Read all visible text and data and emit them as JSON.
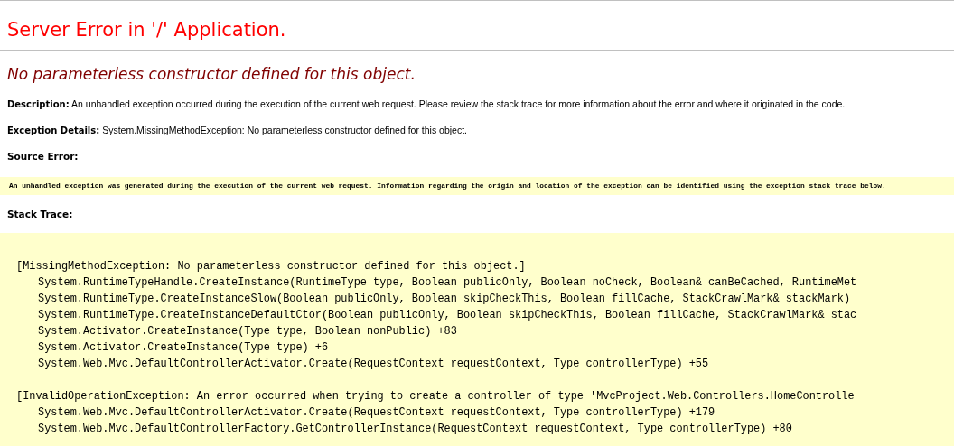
{
  "title": "Server Error in '/' Application.",
  "error_message": "No parameterless constructor defined for this object.",
  "description": {
    "label": "Description:",
    "text": "An unhandled exception occurred during the execution of the current web request. Please review the stack trace for more information about the error and where it originated in the code."
  },
  "exception_details": {
    "label": "Exception Details:",
    "text": "System.MissingMethodException: No parameterless constructor defined for this object."
  },
  "source_error": {
    "label": "Source Error:",
    "message": "An unhandled exception was generated during the execution of the current web request. Information regarding the origin and location of the exception can be identified using the exception stack trace below."
  },
  "stack_trace": {
    "label": "Stack Trace:",
    "blocks": [
      {
        "header": "[MissingMethodException: No parameterless constructor defined for this object.]",
        "frames": [
          "System.RuntimeTypeHandle.CreateInstance(RuntimeType type, Boolean publicOnly, Boolean noCheck, Boolean& canBeCached, RuntimeMet",
          "System.RuntimeType.CreateInstanceSlow(Boolean publicOnly, Boolean skipCheckThis, Boolean fillCache, StackCrawlMark& stackMark)",
          "System.RuntimeType.CreateInstanceDefaultCtor(Boolean publicOnly, Boolean skipCheckThis, Boolean fillCache, StackCrawlMark& stac",
          "System.Activator.CreateInstance(Type type, Boolean nonPublic) +83",
          "System.Activator.CreateInstance(Type type) +6",
          "System.Web.Mvc.DefaultControllerActivator.Create(RequestContext requestContext, Type controllerType) +55"
        ]
      },
      {
        "header": "[InvalidOperationException: An error occurred when trying to create a controller of type 'MvcProject.Web.Controllers.HomeControlle",
        "frames": [
          "System.Web.Mvc.DefaultControllerActivator.Create(RequestContext requestContext, Type controllerType) +179",
          "System.Web.Mvc.DefaultControllerFactory.GetControllerInstance(RequestContext requestContext, Type controllerType) +80"
        ]
      }
    ]
  }
}
